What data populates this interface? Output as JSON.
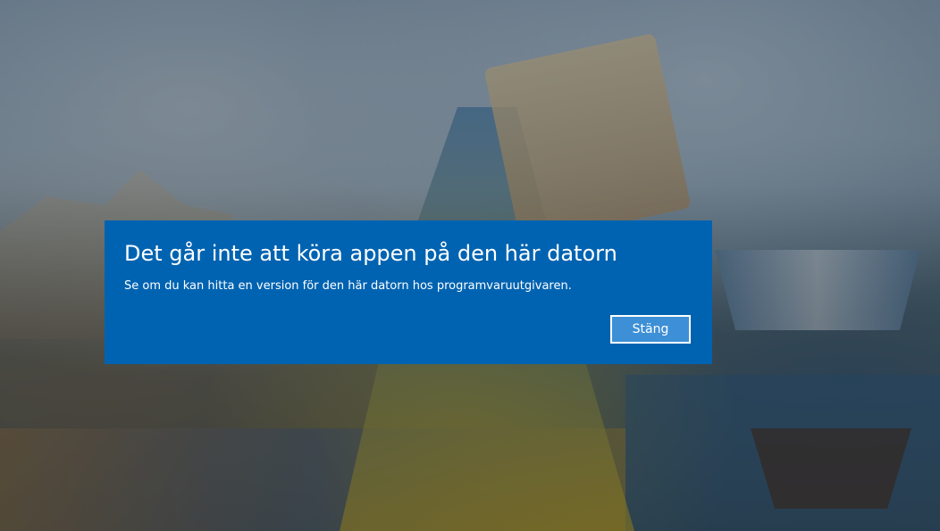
{
  "dialog": {
    "title": "Det går inte att köra appen på den här datorn",
    "message": "Se om du kan hitta en version för den här datorn hos programvaruutgivaren.",
    "close_label": "Stäng",
    "accent_color": "#0063b1"
  }
}
